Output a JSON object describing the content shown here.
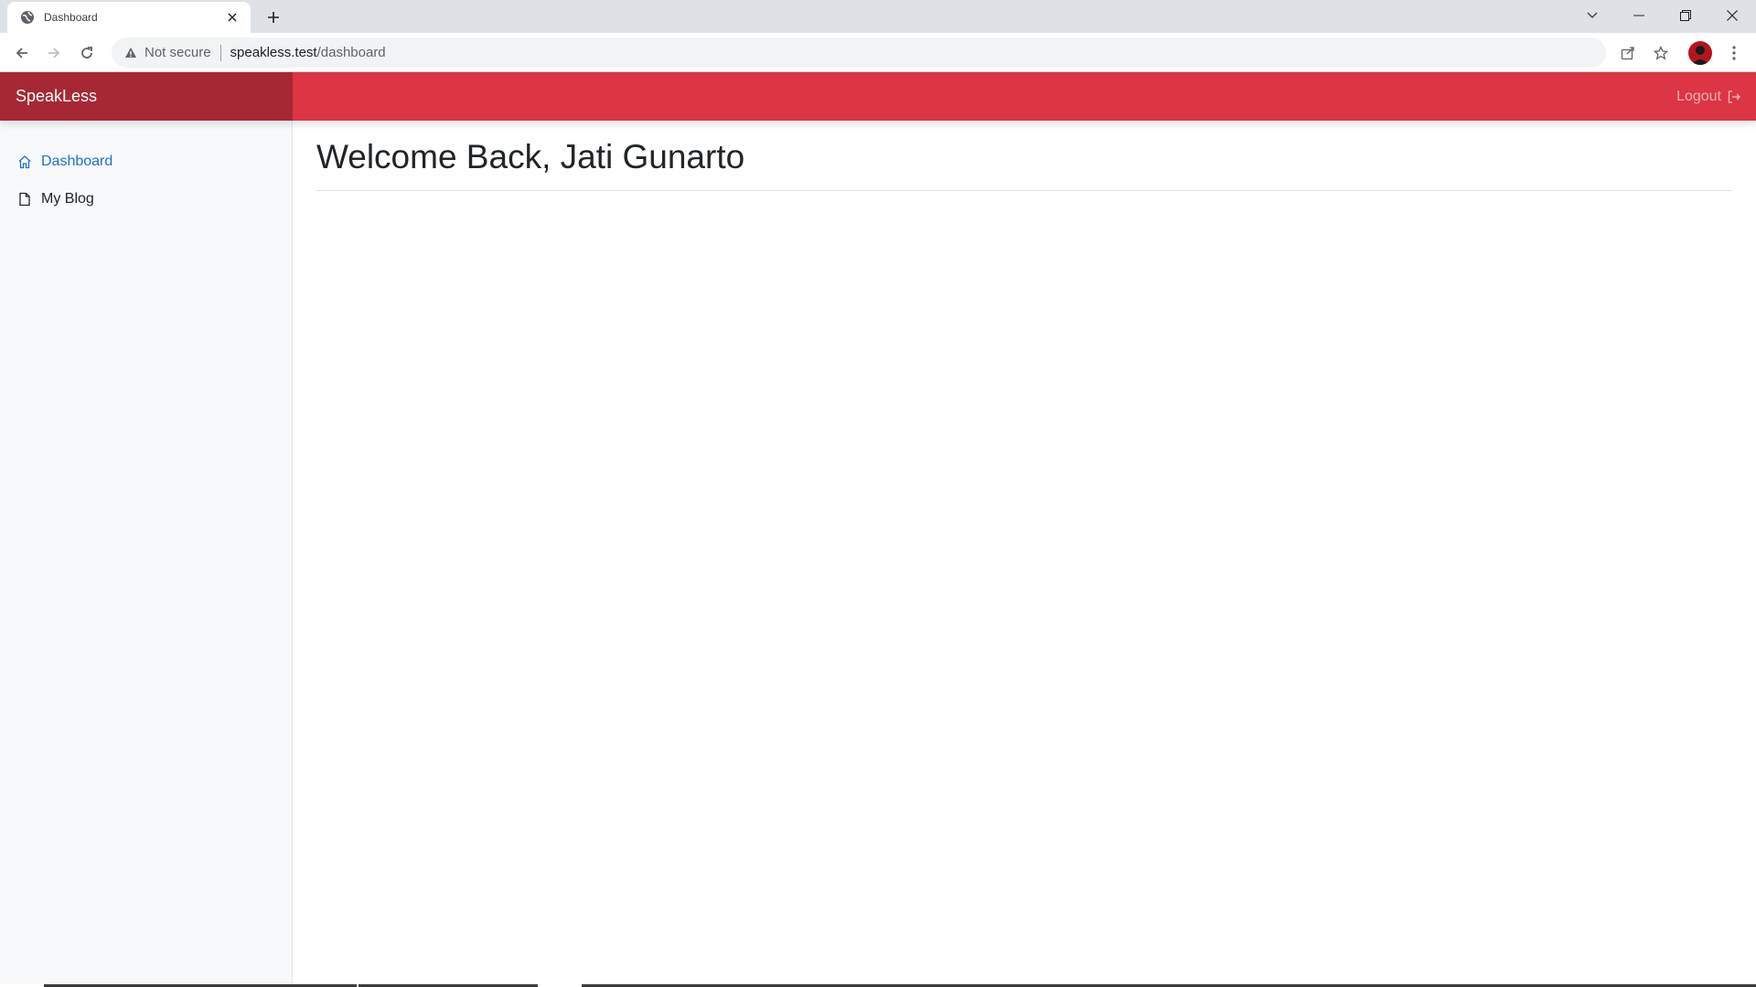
{
  "browser": {
    "tab_title": "Dashboard",
    "security_label": "Not secure",
    "url_host": "speakless.test",
    "url_path": "/dashboard"
  },
  "app": {
    "brand": "SpeakLess",
    "logout_label": "Logout",
    "accent_color": "#dc3545",
    "brand_bg_color": "#a62834"
  },
  "sidebar": {
    "items": [
      {
        "label": "Dashboard",
        "icon": "home-icon",
        "active": true
      },
      {
        "label": "My Blog",
        "icon": "file-icon",
        "active": false
      }
    ]
  },
  "main": {
    "title": "Welcome Back, Jati Gunarto"
  }
}
